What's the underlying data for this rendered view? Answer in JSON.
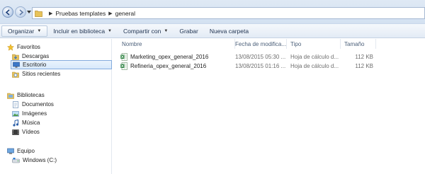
{
  "address": {
    "crumbs": [
      "Pruebas templates",
      "general"
    ]
  },
  "toolbar": {
    "organize": "Organizar",
    "include_library": "Incluir en biblioteca",
    "share": "Compartir con",
    "burn": "Grabar",
    "new_folder": "Nueva carpeta"
  },
  "nav": {
    "favorites": "Favoritos",
    "downloads": "Descargas",
    "desktop": "Escritorio",
    "recent": "Sitios recientes",
    "libraries": "Bibliotecas",
    "documents": "Documentos",
    "pictures": "Imágenes",
    "music": "Música",
    "videos": "Vídeos",
    "computer": "Equipo",
    "drive_c": "Windows (C:)"
  },
  "columns": {
    "name": "Nombre",
    "modified": "Fecha de modifica...",
    "type": "Tipo",
    "size": "Tamaño"
  },
  "files": [
    {
      "name": "Marketing_opex_general_2016",
      "modified": "13/08/2015 05:30 ...",
      "type": "Hoja de cálculo d...",
      "size": "112 KB"
    },
    {
      "name": "Refineria_opex_general_2016",
      "modified": "13/08/2015 01:16 ...",
      "type": "Hoja de cálculo d...",
      "size": "112 KB"
    }
  ],
  "colors": {
    "selection": "#d7e9fb",
    "excel_green": "#1e7a35"
  }
}
